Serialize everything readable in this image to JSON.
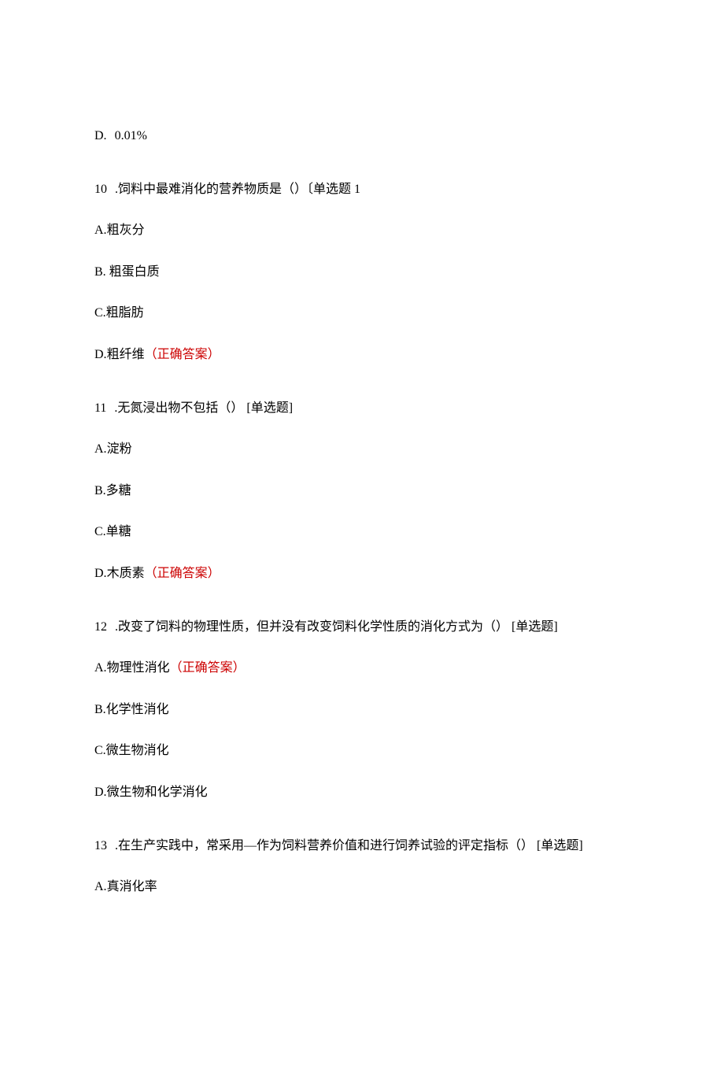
{
  "top_option": {
    "letter": "D.",
    "text": "0.01%"
  },
  "questions": [
    {
      "number": "10",
      "stem": ".饲料中最难消化的营养物质是（）〔单选题 1",
      "options": [
        {
          "letter": "A.",
          "text": "粗灰分",
          "correct": false
        },
        {
          "letter": "B. ",
          "text": "粗蛋白质",
          "correct": false
        },
        {
          "letter": "C.",
          "text": "粗脂肪",
          "correct": false
        },
        {
          "letter": "D.",
          "text": "粗纤维",
          "correct": true
        }
      ]
    },
    {
      "number": "11",
      "stem": ".无氮浸出物不包括（） [单选题]",
      "options": [
        {
          "letter": "A.",
          "text": "淀粉",
          "correct": false
        },
        {
          "letter": "B.",
          "text": "多糖",
          "correct": false
        },
        {
          "letter": "C.",
          "text": "单糖",
          "correct": false
        },
        {
          "letter": "D.",
          "text": "木质素",
          "correct": true
        }
      ]
    },
    {
      "number": "12",
      "stem": ".改变了饲料的物理性质，但并没有改变饲料化学性质的消化方式为（） [单选题]",
      "options": [
        {
          "letter": "A.",
          "text": "物理性消化",
          "correct": true
        },
        {
          "letter": "B.",
          "text": "化学性消化",
          "correct": false
        },
        {
          "letter": "C.",
          "text": "微生物消化",
          "correct": false
        },
        {
          "letter": "D.",
          "text": "微生物和化学消化",
          "correct": false
        }
      ]
    },
    {
      "number": "13",
      "stem": ".在生产实践中，常采用—作为饲料营养价值和进行饲养试验的评定指标（） [单选题]",
      "options": [
        {
          "letter": "A.",
          "text": "真消化率",
          "correct": false
        }
      ]
    }
  ],
  "correct_label": "（正确答案）"
}
